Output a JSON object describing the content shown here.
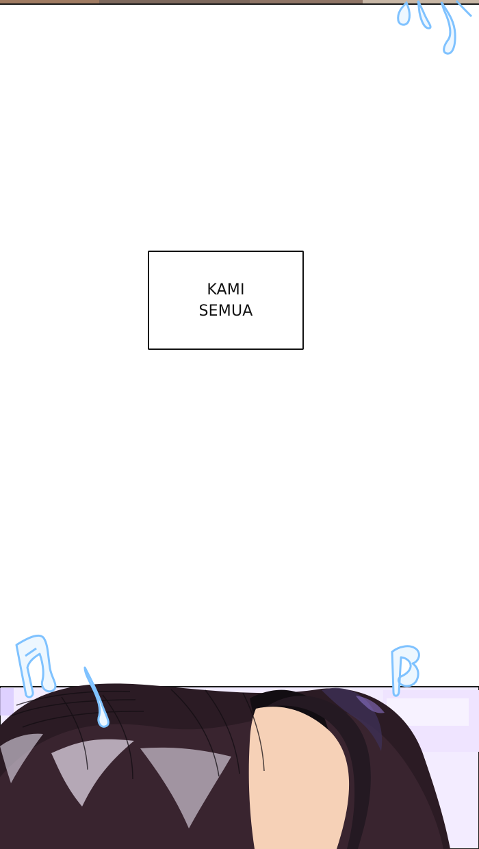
{
  "caption": {
    "lines": [
      "KAMI",
      "SEMUA"
    ]
  },
  "top_panel": {
    "description_icon": "music-notes-icon",
    "note_color": "#a9d4ff"
  },
  "bottom_panel": {
    "hair_color": "#2a1d24",
    "background_color": "#f3e9ff",
    "skin_color": "#f6d1b7",
    "note_icons": [
      "music-note-icon",
      "music-note-icon",
      "music-note-icon"
    ]
  }
}
